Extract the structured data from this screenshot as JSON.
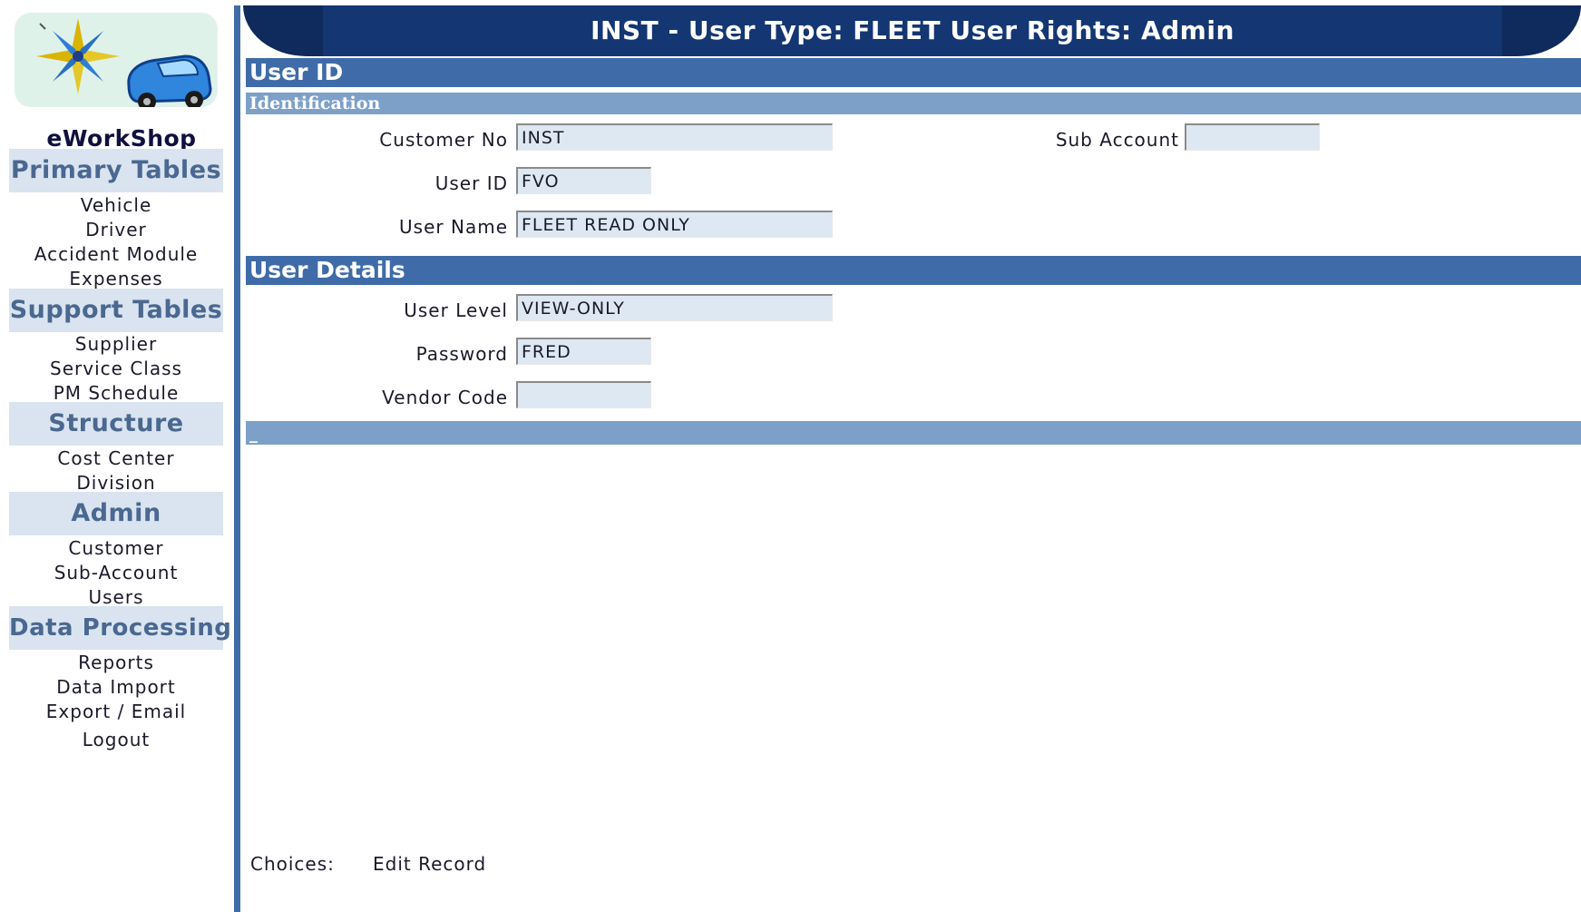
{
  "app": {
    "brand": "eWorkShop",
    "banner_title": "INST - User Type: FLEET User Rights: Admin"
  },
  "sidebar": {
    "groups": [
      {
        "title": "Primary Tables",
        "items": [
          "Vehicle",
          "Driver",
          "Accident Module",
          "Expenses"
        ]
      },
      {
        "title": "Support Tables",
        "items": [
          "Supplier",
          "Service Class",
          "PM Schedule"
        ]
      },
      {
        "title": "Structure",
        "items": [
          "Cost Center",
          "Division"
        ]
      },
      {
        "title": "Admin",
        "items": [
          "Customer",
          "Sub-Account",
          "Users"
        ]
      },
      {
        "title": "Data Processing",
        "items": [
          "Reports",
          "Data Import",
          "Export / Email"
        ]
      }
    ],
    "logout": "Logout"
  },
  "sections": {
    "user_id": "User ID",
    "identification": "Identification",
    "user_details": "User Details",
    "blank_bar": "_"
  },
  "fields": {
    "customer_no": {
      "label": "Customer No",
      "value": "INST"
    },
    "sub_account": {
      "label": "Sub Account",
      "value": ""
    },
    "user_id": {
      "label": "User ID",
      "value": "FVO"
    },
    "user_name": {
      "label": "User Name",
      "value": "FLEET READ ONLY"
    },
    "user_level": {
      "label": "User Level",
      "value": "VIEW-ONLY"
    },
    "password": {
      "label": "Password",
      "value": "FRED"
    },
    "vendor_code": {
      "label": "Vendor Code",
      "value": ""
    }
  },
  "choices": {
    "label": "Choices:",
    "edit_record": "Edit Record"
  },
  "colors": {
    "banner": "#143672",
    "section_dark": "#3f6ca8",
    "section_light": "#7da0c8",
    "nav_group_bg": "#d9e4f0",
    "field_bg": "#dde8f2"
  },
  "icons": {
    "logo": "compass-car-logo"
  }
}
